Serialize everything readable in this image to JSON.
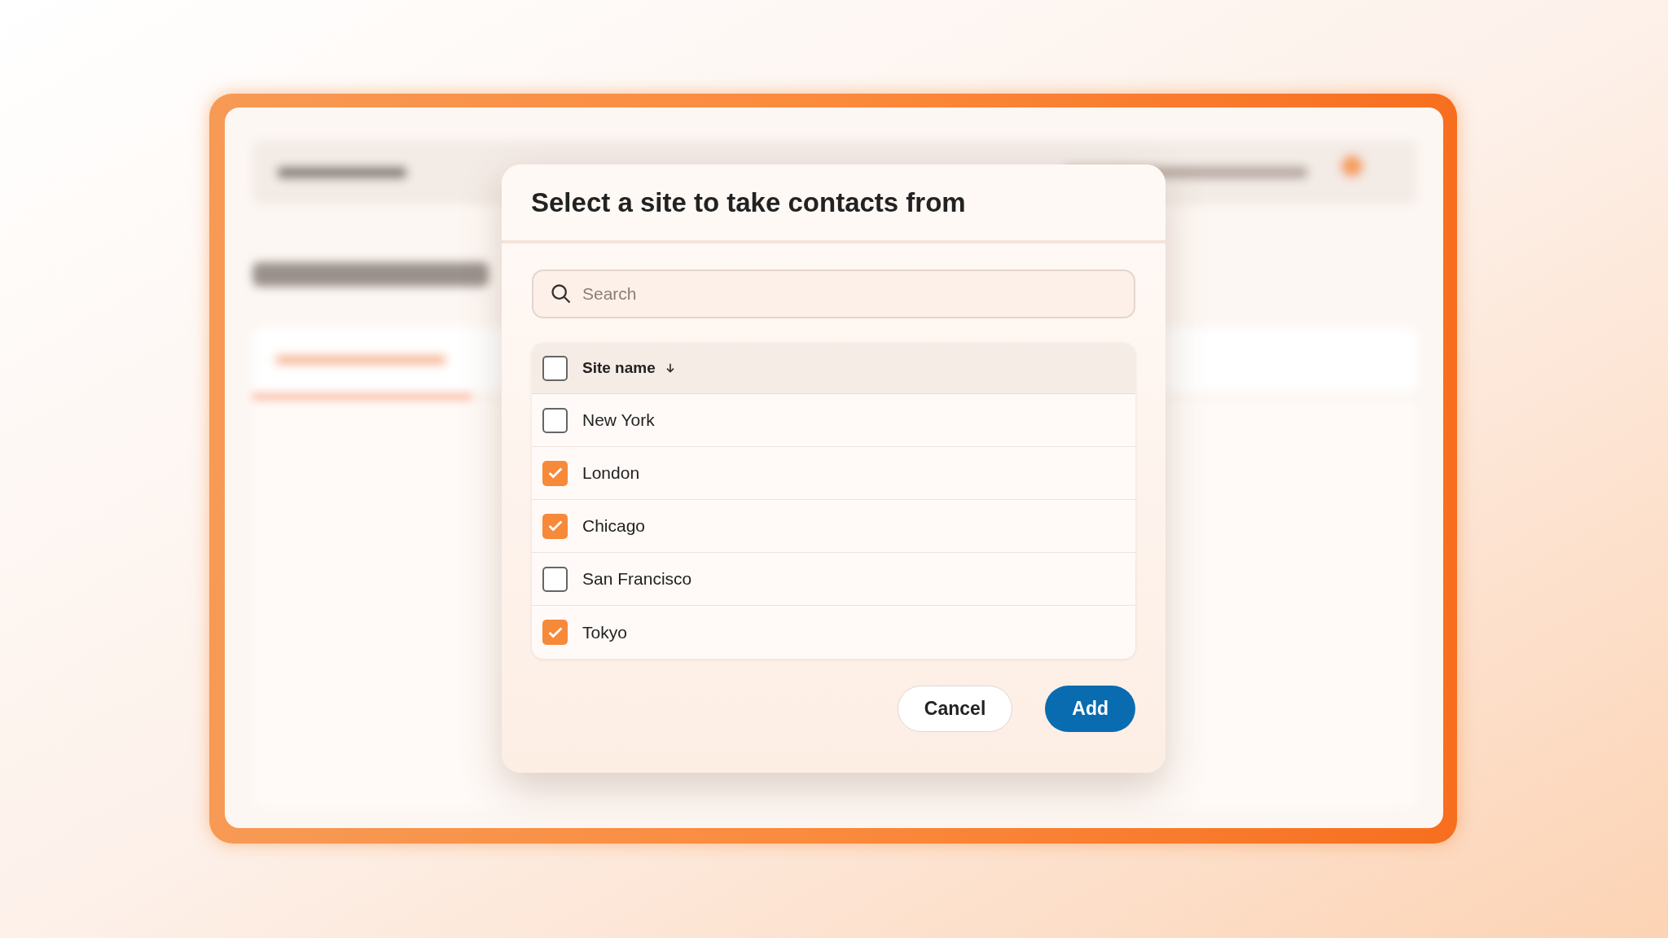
{
  "dialog": {
    "title": "Select a site to take contacts from",
    "search": {
      "placeholder": "Search"
    },
    "table": {
      "header": {
        "label": "Site name",
        "checked": false,
        "sort_descending": true
      },
      "rows": [
        {
          "name": "New York",
          "checked": false
        },
        {
          "name": "London",
          "checked": true
        },
        {
          "name": "Chicago",
          "checked": true
        },
        {
          "name": "San Francisco",
          "checked": false
        },
        {
          "name": "Tokyo",
          "checked": true
        }
      ]
    },
    "buttons": [
      {
        "label": "Cancel",
        "kind": "secondary"
      },
      {
        "label": "Add",
        "kind": "primary"
      }
    ]
  }
}
